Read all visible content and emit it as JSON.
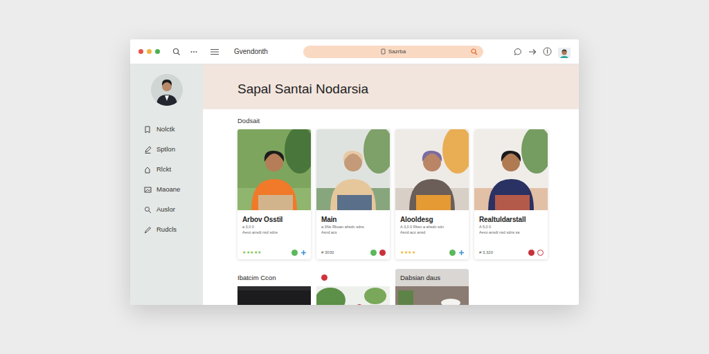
{
  "window": {
    "title": "Gvendonth"
  },
  "search": {
    "value": "Sazrba"
  },
  "sidebar": {
    "items": [
      {
        "label": "Nolctk"
      },
      {
        "label": "Sptlon"
      },
      {
        "label": "Rlckt"
      },
      {
        "label": "Maoane"
      },
      {
        "label": "Auslor"
      },
      {
        "label": "Rudcls"
      }
    ]
  },
  "header": {
    "title": "Sapal Santai Nodarsia"
  },
  "featured": {
    "title": "Dodsait",
    "cards": [
      {
        "title": "Arbov Osstil",
        "lines": [
          "a 3,0 0",
          "Aevo ansdt nsd sdns"
        ],
        "kind": "rated",
        "stars": 5,
        "star_color": "#7cc24a",
        "marks": [
          {
            "kind": "dot",
            "color": "#5cb85c"
          },
          {
            "kind": "plus",
            "color": "#3b8fd6"
          }
        ]
      },
      {
        "title": "Main",
        "lines": [
          "a 3Ns Rboan ahsdn sdns",
          "Asnd acs"
        ],
        "kind": "priced",
        "price": "# 3030",
        "marks": [
          {
            "kind": "dot",
            "color": "#5cb85c"
          },
          {
            "kind": "dot",
            "color": "#c8323c"
          }
        ]
      },
      {
        "title": "Alooldesg",
        "lines": [
          "A 3,0 0 Rbsn a ahsdn sdn",
          "Asnd aco ansd"
        ],
        "kind": "rated",
        "stars": 4,
        "star_color": "#f0b429",
        "marks": [
          {
            "kind": "dot",
            "color": "#5cb85c"
          },
          {
            "kind": "plus",
            "color": "#3b8fd6"
          }
        ]
      },
      {
        "title": "Realtuldarstall",
        "lines": [
          "A 5,0 0",
          "Aevo ansdt nsd sdns sa"
        ],
        "kind": "priced",
        "price": "# 3,320",
        "marks": [
          {
            "kind": "dot",
            "color": "#c8323c"
          },
          {
            "kind": "ring",
            "color": "#c8323c"
          }
        ]
      }
    ]
  },
  "more": {
    "tiles": [
      {
        "kind": "caption",
        "label": "Ibatcim Ccon"
      },
      {
        "kind": "badge",
        "color": "#d0343a"
      },
      {
        "kind": "strip",
        "label": "Dabsian daus"
      }
    ]
  }
}
